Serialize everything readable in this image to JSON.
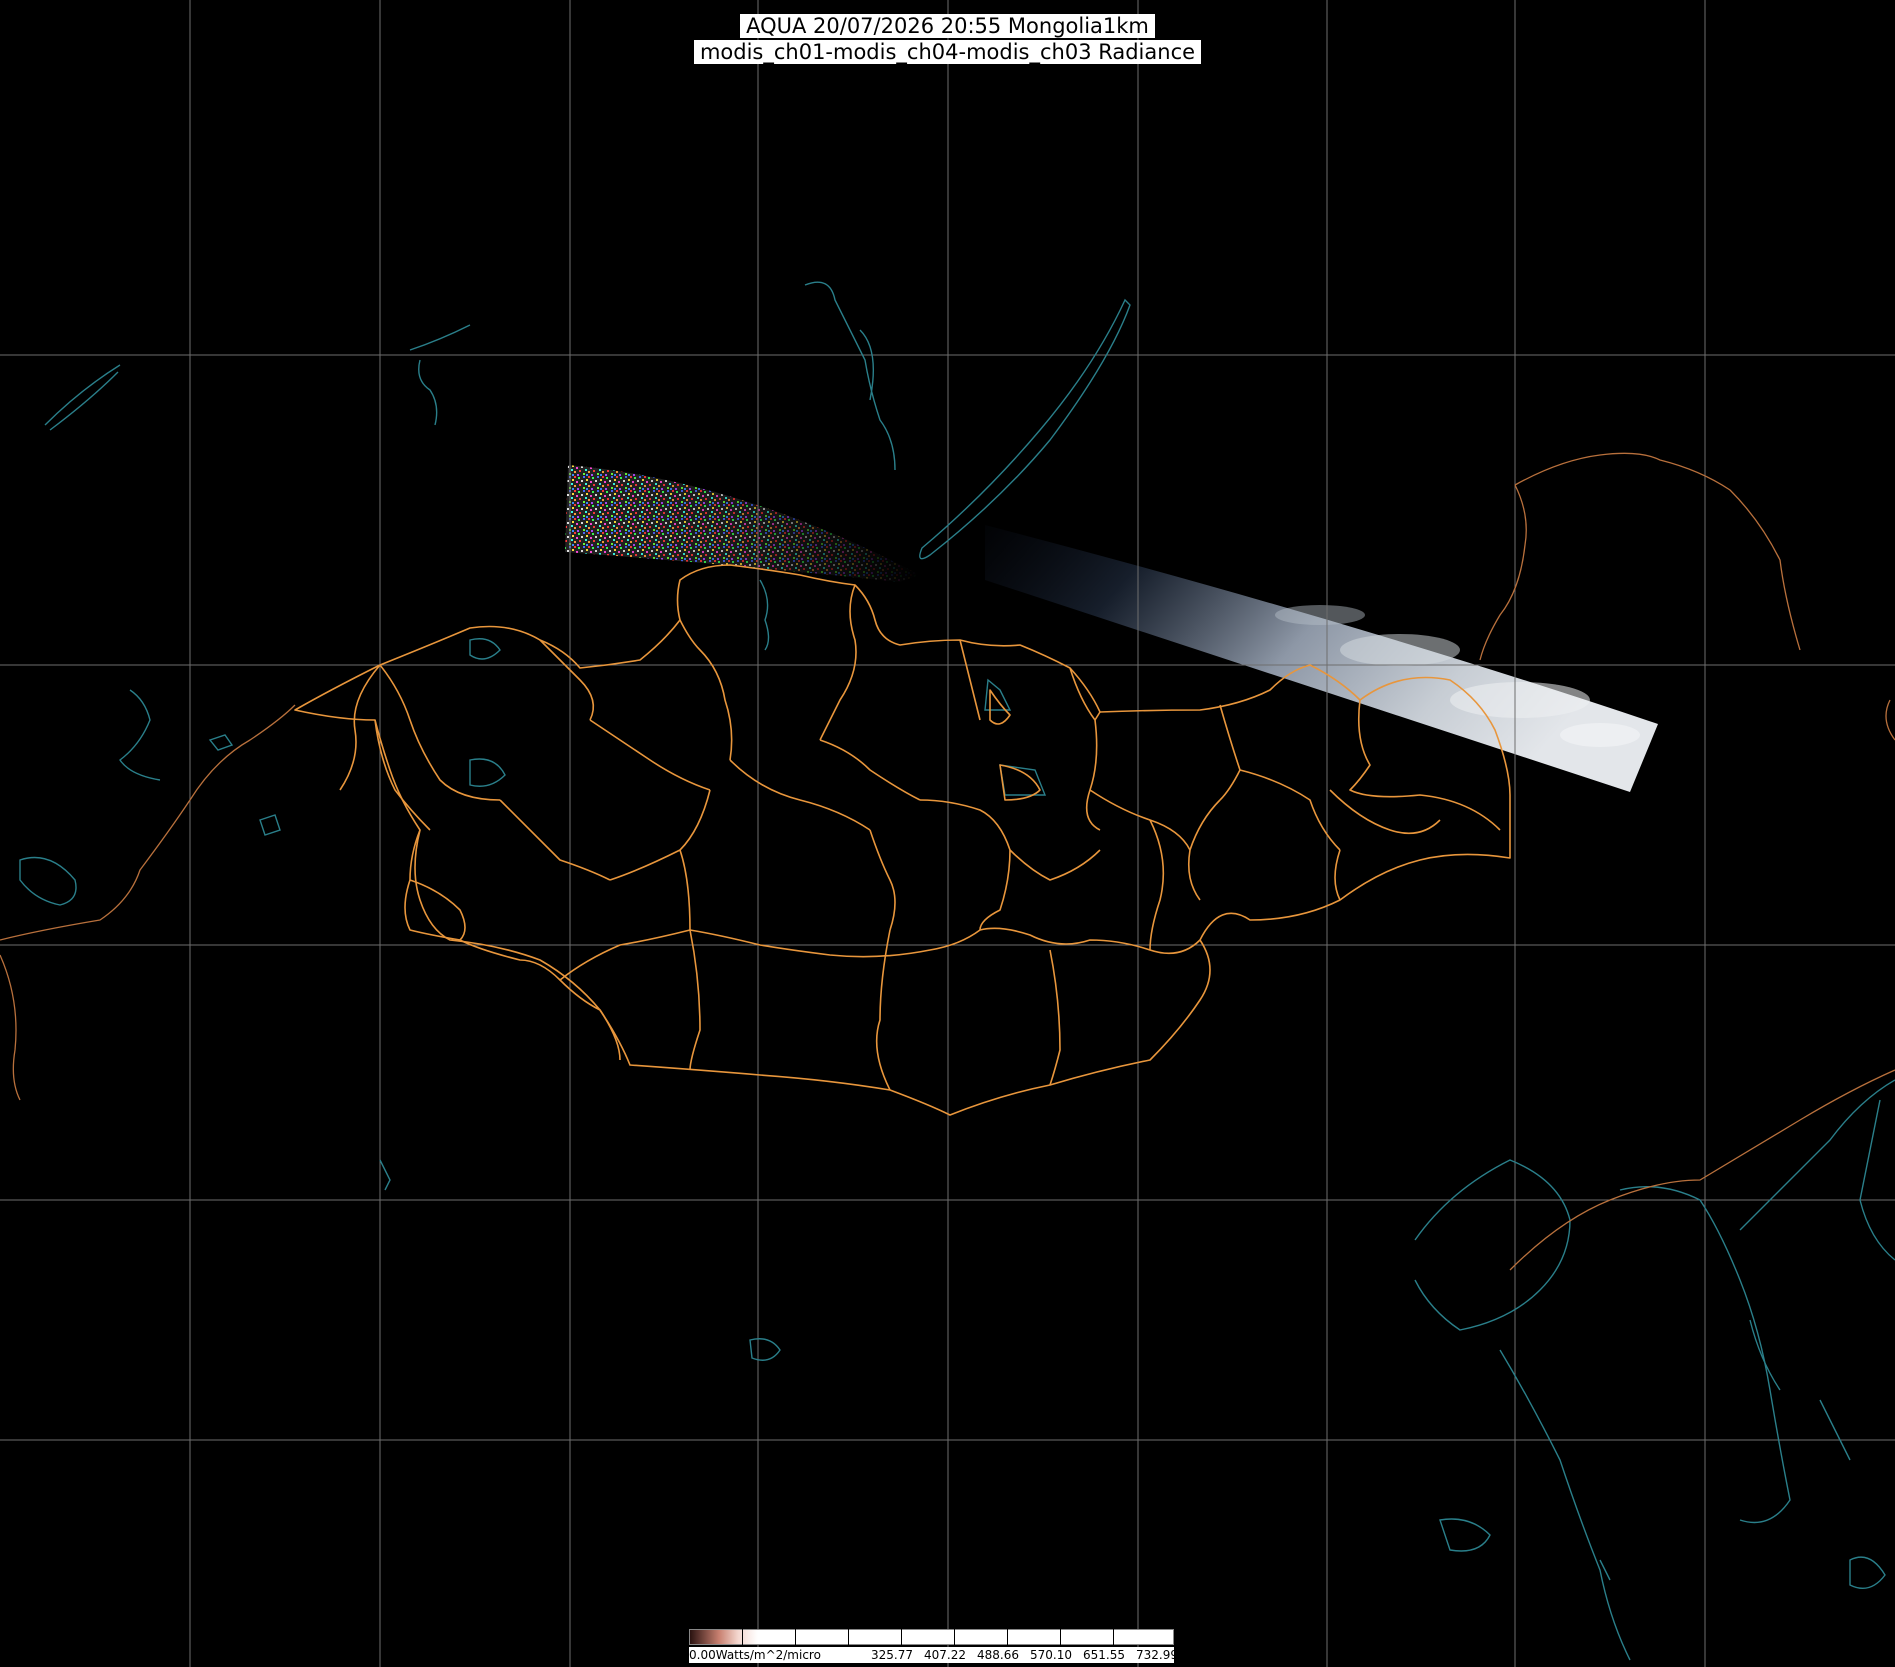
{
  "title": {
    "line1": "AQUA 20/07/2026 20:55 Mongolia1km",
    "line2": "modis_ch01-modis_ch04-modis_ch03 Radiance"
  },
  "colorbar": {
    "unit_label": "0.00Watts/m^2/micro",
    "ticks": [
      "325.77",
      "407.22",
      "488.66",
      "570.10",
      "651.55",
      "732.99"
    ]
  },
  "colors": {
    "background": "#000000",
    "graticule": "#6e6e6e",
    "mongolia_borders": "#e8963c",
    "coastlines_water": "#2a7f8a",
    "national_borders": "#b8703c"
  }
}
